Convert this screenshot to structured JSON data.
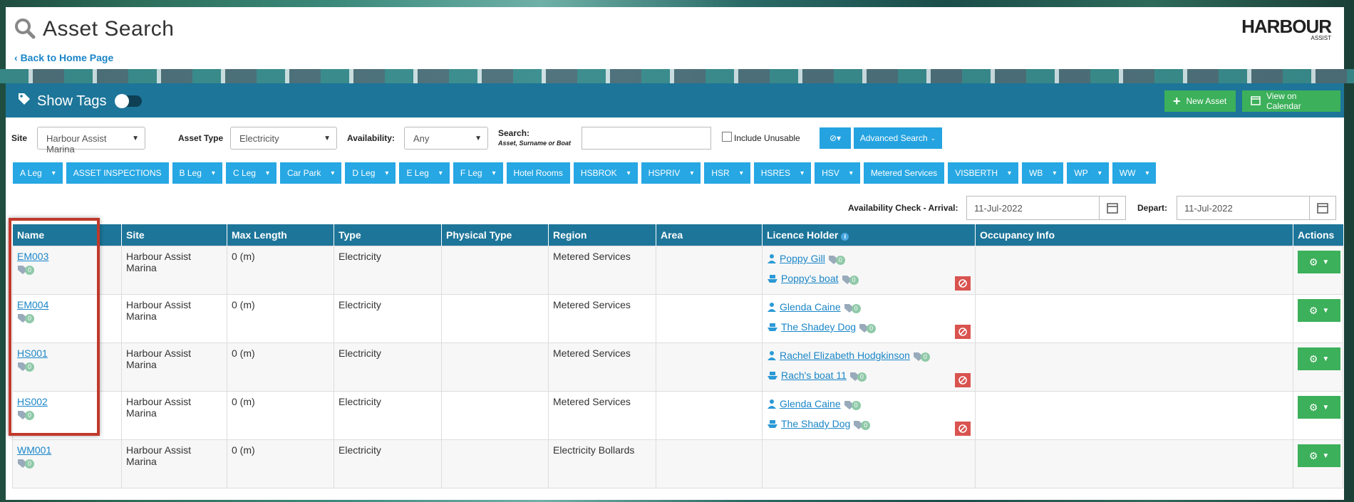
{
  "header": {
    "title": "Asset Search",
    "back_link": "Back to Home Page",
    "logo": {
      "main": "HARBOUR",
      "sub": "ASSIST"
    }
  },
  "panel": {
    "show_tags_label": "Show Tags",
    "new_asset_label": "New Asset",
    "view_calendar_label": "View on Calendar"
  },
  "filters": {
    "site_label": "Site",
    "site_value": "Harbour Assist Marina",
    "asset_type_label": "Asset Type",
    "asset_type_value": "Electricity",
    "availability_label": "Availability:",
    "availability_value": "Any",
    "search_label": "Search:",
    "search_hint": "Asset, Surname or Boat",
    "search_value": "",
    "include_unusable_label": "Include Unusable",
    "advanced_search_label": "Advanced Search"
  },
  "tags": [
    {
      "label": "A Leg",
      "dropdown": true
    },
    {
      "label": "ASSET INSPECTIONS",
      "dropdown": false
    },
    {
      "label": "B Leg",
      "dropdown": true
    },
    {
      "label": "C Leg",
      "dropdown": true
    },
    {
      "label": "Car Park",
      "dropdown": true
    },
    {
      "label": "D Leg",
      "dropdown": true
    },
    {
      "label": "E Leg",
      "dropdown": true
    },
    {
      "label": "F Leg",
      "dropdown": true
    },
    {
      "label": "Hotel Rooms",
      "dropdown": false
    },
    {
      "label": "HSBROK",
      "dropdown": true
    },
    {
      "label": "HSPRIV",
      "dropdown": true
    },
    {
      "label": "HSR",
      "dropdown": true
    },
    {
      "label": "HSRES",
      "dropdown": true
    },
    {
      "label": "HSV",
      "dropdown": true
    },
    {
      "label": "Metered Services",
      "dropdown": false
    },
    {
      "label": "VISBERTH",
      "dropdown": true
    },
    {
      "label": "WB",
      "dropdown": true
    },
    {
      "label": "WP",
      "dropdown": true
    },
    {
      "label": "WW",
      "dropdown": true
    }
  ],
  "availability_check": {
    "arrival_label": "Availability Check - Arrival:",
    "arrival_value": "11-Jul-2022",
    "depart_label": "Depart:",
    "depart_value": "11-Jul-2022"
  },
  "table": {
    "columns": [
      "Name",
      "Site",
      "Max Length",
      "Type",
      "Physical Type",
      "Region",
      "Area",
      "Licence Holder",
      "Occupancy Info",
      "Actions"
    ],
    "rows": [
      {
        "name": "EM003",
        "tag_count": "0",
        "site": "Harbour Assist Marina",
        "max_length": "0 (m)",
        "type": "Electricity",
        "physical_type": "",
        "region": "Metered Services",
        "area": "",
        "holder": "Poppy Gill",
        "holder_count": "0",
        "boat": "Poppy's boat",
        "boat_count": "0",
        "occupancy": ""
      },
      {
        "name": "EM004",
        "tag_count": "0",
        "site": "Harbour Assist Marina",
        "max_length": "0 (m)",
        "type": "Electricity",
        "physical_type": "",
        "region": "Metered Services",
        "area": "",
        "holder": "Glenda Caine",
        "holder_count": "0",
        "boat": "The Shadey Dog",
        "boat_count": "0",
        "occupancy": ""
      },
      {
        "name": "HS001",
        "tag_count": "0",
        "site": "Harbour Assist Marina",
        "max_length": "0 (m)",
        "type": "Electricity",
        "physical_type": "",
        "region": "Metered Services",
        "area": "",
        "holder": "Rachel Elizabeth Hodgkinson",
        "holder_count": "0",
        "boat": "Rach's boat 11",
        "boat_count": "0",
        "occupancy": ""
      },
      {
        "name": "HS002",
        "tag_count": "0",
        "site": "Harbour Assist Marina",
        "max_length": "0 (m)",
        "type": "Electricity",
        "physical_type": "",
        "region": "Metered Services",
        "area": "",
        "holder": "Glenda Caine",
        "holder_count": "0",
        "boat": "The Shady Dog",
        "boat_count": "0",
        "occupancy": ""
      },
      {
        "name": "WM001",
        "tag_count": "0",
        "site": "Harbour Assist Marina",
        "max_length": "0 (m)",
        "type": "Electricity",
        "physical_type": "",
        "region": "Electricity Bollards",
        "area": "",
        "occupancy": ""
      }
    ]
  }
}
